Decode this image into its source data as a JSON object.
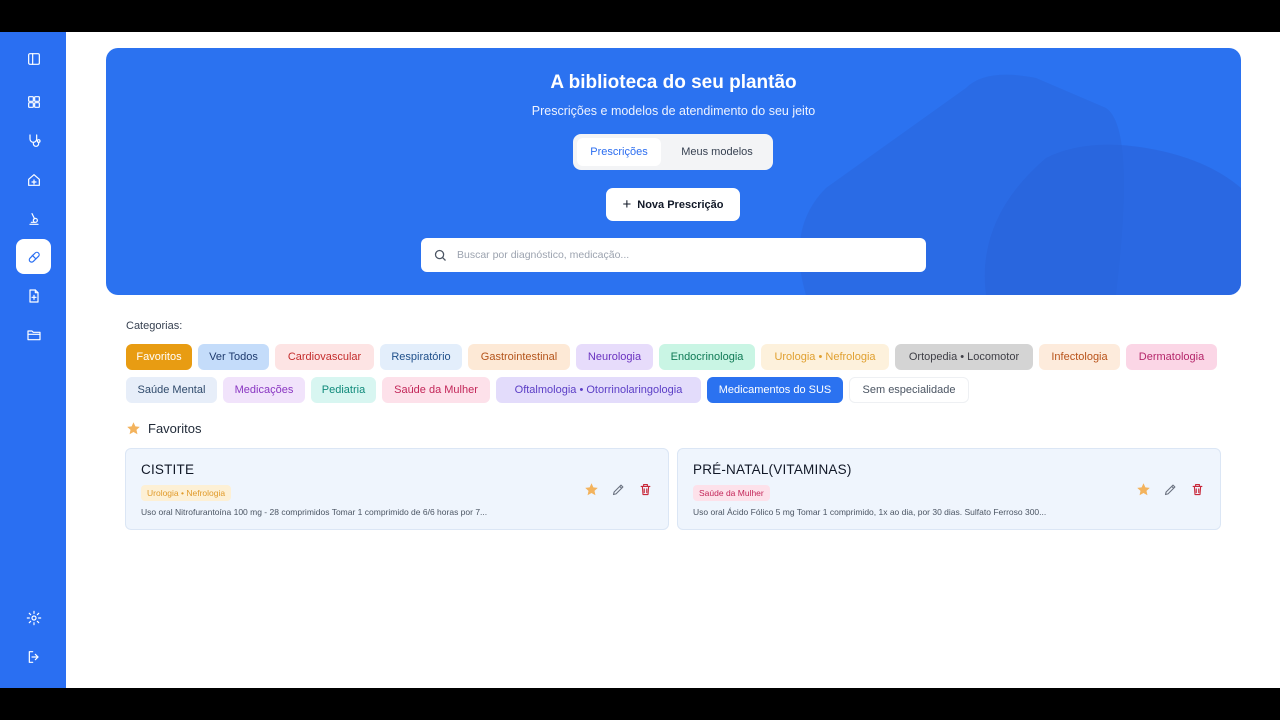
{
  "hero": {
    "title": "A biblioteca do seu plantão",
    "subtitle": "Prescrições e modelos de atendimento do seu jeito",
    "tabs": [
      "Prescrições",
      "Meus modelos"
    ],
    "new_button_label": "Nova Prescrição",
    "search_placeholder": "Buscar por diagnóstico, medicação..."
  },
  "categories": {
    "label": "Categorias:",
    "row1": [
      {
        "label": "Favoritos",
        "bg": "#e89c12",
        "fg": "#ffffff"
      },
      {
        "label": "Ver Todos",
        "bg": "#c4dcfa",
        "fg": "#1e3a6e"
      },
      {
        "label": "Cardiovascular",
        "bg": "#fde4e4",
        "fg": "#c42d2d"
      },
      {
        "label": "Respiratório",
        "bg": "#e3eefb",
        "fg": "#1e4f8a"
      },
      {
        "label": "Gastrointestinal",
        "bg": "#fde9d6",
        "fg": "#b4541b"
      },
      {
        "label": "Neurologia",
        "bg": "#e7dcfb",
        "fg": "#6a32c0"
      },
      {
        "label": "Endocrinologia",
        "bg": "#c9f5e4",
        "fg": "#0f7a55"
      },
      {
        "label": "Urologia • Nefrologia",
        "bg": "#fdf1dc",
        "fg": "#e0a030"
      },
      {
        "label": "Ortopedia • Locomotor",
        "bg": "#d4d4d4",
        "fg": "#3f3f46"
      },
      {
        "label": "Infectologia",
        "bg": "#fdebdc",
        "fg": "#b9531a"
      },
      {
        "label": "Dermatologia",
        "bg": "#fbd6e6",
        "fg": "#b5266a"
      }
    ],
    "row2": [
      {
        "label": "Saúde Mental",
        "bg": "#e7eef9",
        "fg": "#2f4a6b"
      },
      {
        "label": "Medicações",
        "bg": "#f1e3fb",
        "fg": "#8a36c2"
      },
      {
        "label": "Pediatria",
        "bg": "#d8f6f1",
        "fg": "#0f8a7a"
      },
      {
        "label": "Saúde da Mulher",
        "bg": "#fde1ea",
        "fg": "#c32659"
      },
      {
        "label": "Oftalmologia • Otorrinolaringologia",
        "bg": "#e3dcfb",
        "fg": "#5b3ec6"
      },
      {
        "label": "Medicamentos do SUS",
        "bg": "#2b72f0",
        "fg": "#ffffff"
      },
      {
        "label": "Sem especialidade",
        "bg": "#ffffff",
        "fg": "#4b5563"
      }
    ]
  },
  "favorites": {
    "heading": "Favoritos",
    "cards": [
      {
        "title": "CISTITE",
        "tag": "Urologia • Nefrologia",
        "tag_bg": "#fdf0d5",
        "tag_fg": "#e09a2a",
        "description": "Uso oral Nitrofurantoína 100 mg - 28 comprimidos Tomar 1 comprimido de 6/6 horas por 7..."
      },
      {
        "title": "PRÉ-NATAL(VITAMINAS)",
        "tag": "Saúde da Mulher",
        "tag_bg": "#fde1ea",
        "tag_fg": "#c32659",
        "description": "Uso oral Ácido Fólico 5 mg Tomar 1 comprimido, 1x ao dia, por 30 dias. Sulfato Ferroso 300..."
      }
    ]
  },
  "colors": {
    "sidebar": "#2a6ff2",
    "accent": "#2b72f0",
    "star": "#f3b35d",
    "delete": "#c8283a"
  },
  "icons": {
    "sidebar": [
      "sidebar-toggle-icon",
      "dashboard-icon",
      "stethoscope-icon",
      "home-health-icon",
      "microscope-icon",
      "pill-icon",
      "file-plus-icon",
      "folder-icon",
      "settings-icon",
      "logout-icon"
    ],
    "card_actions": [
      "star-icon",
      "pencil-icon",
      "trash-icon"
    ]
  }
}
